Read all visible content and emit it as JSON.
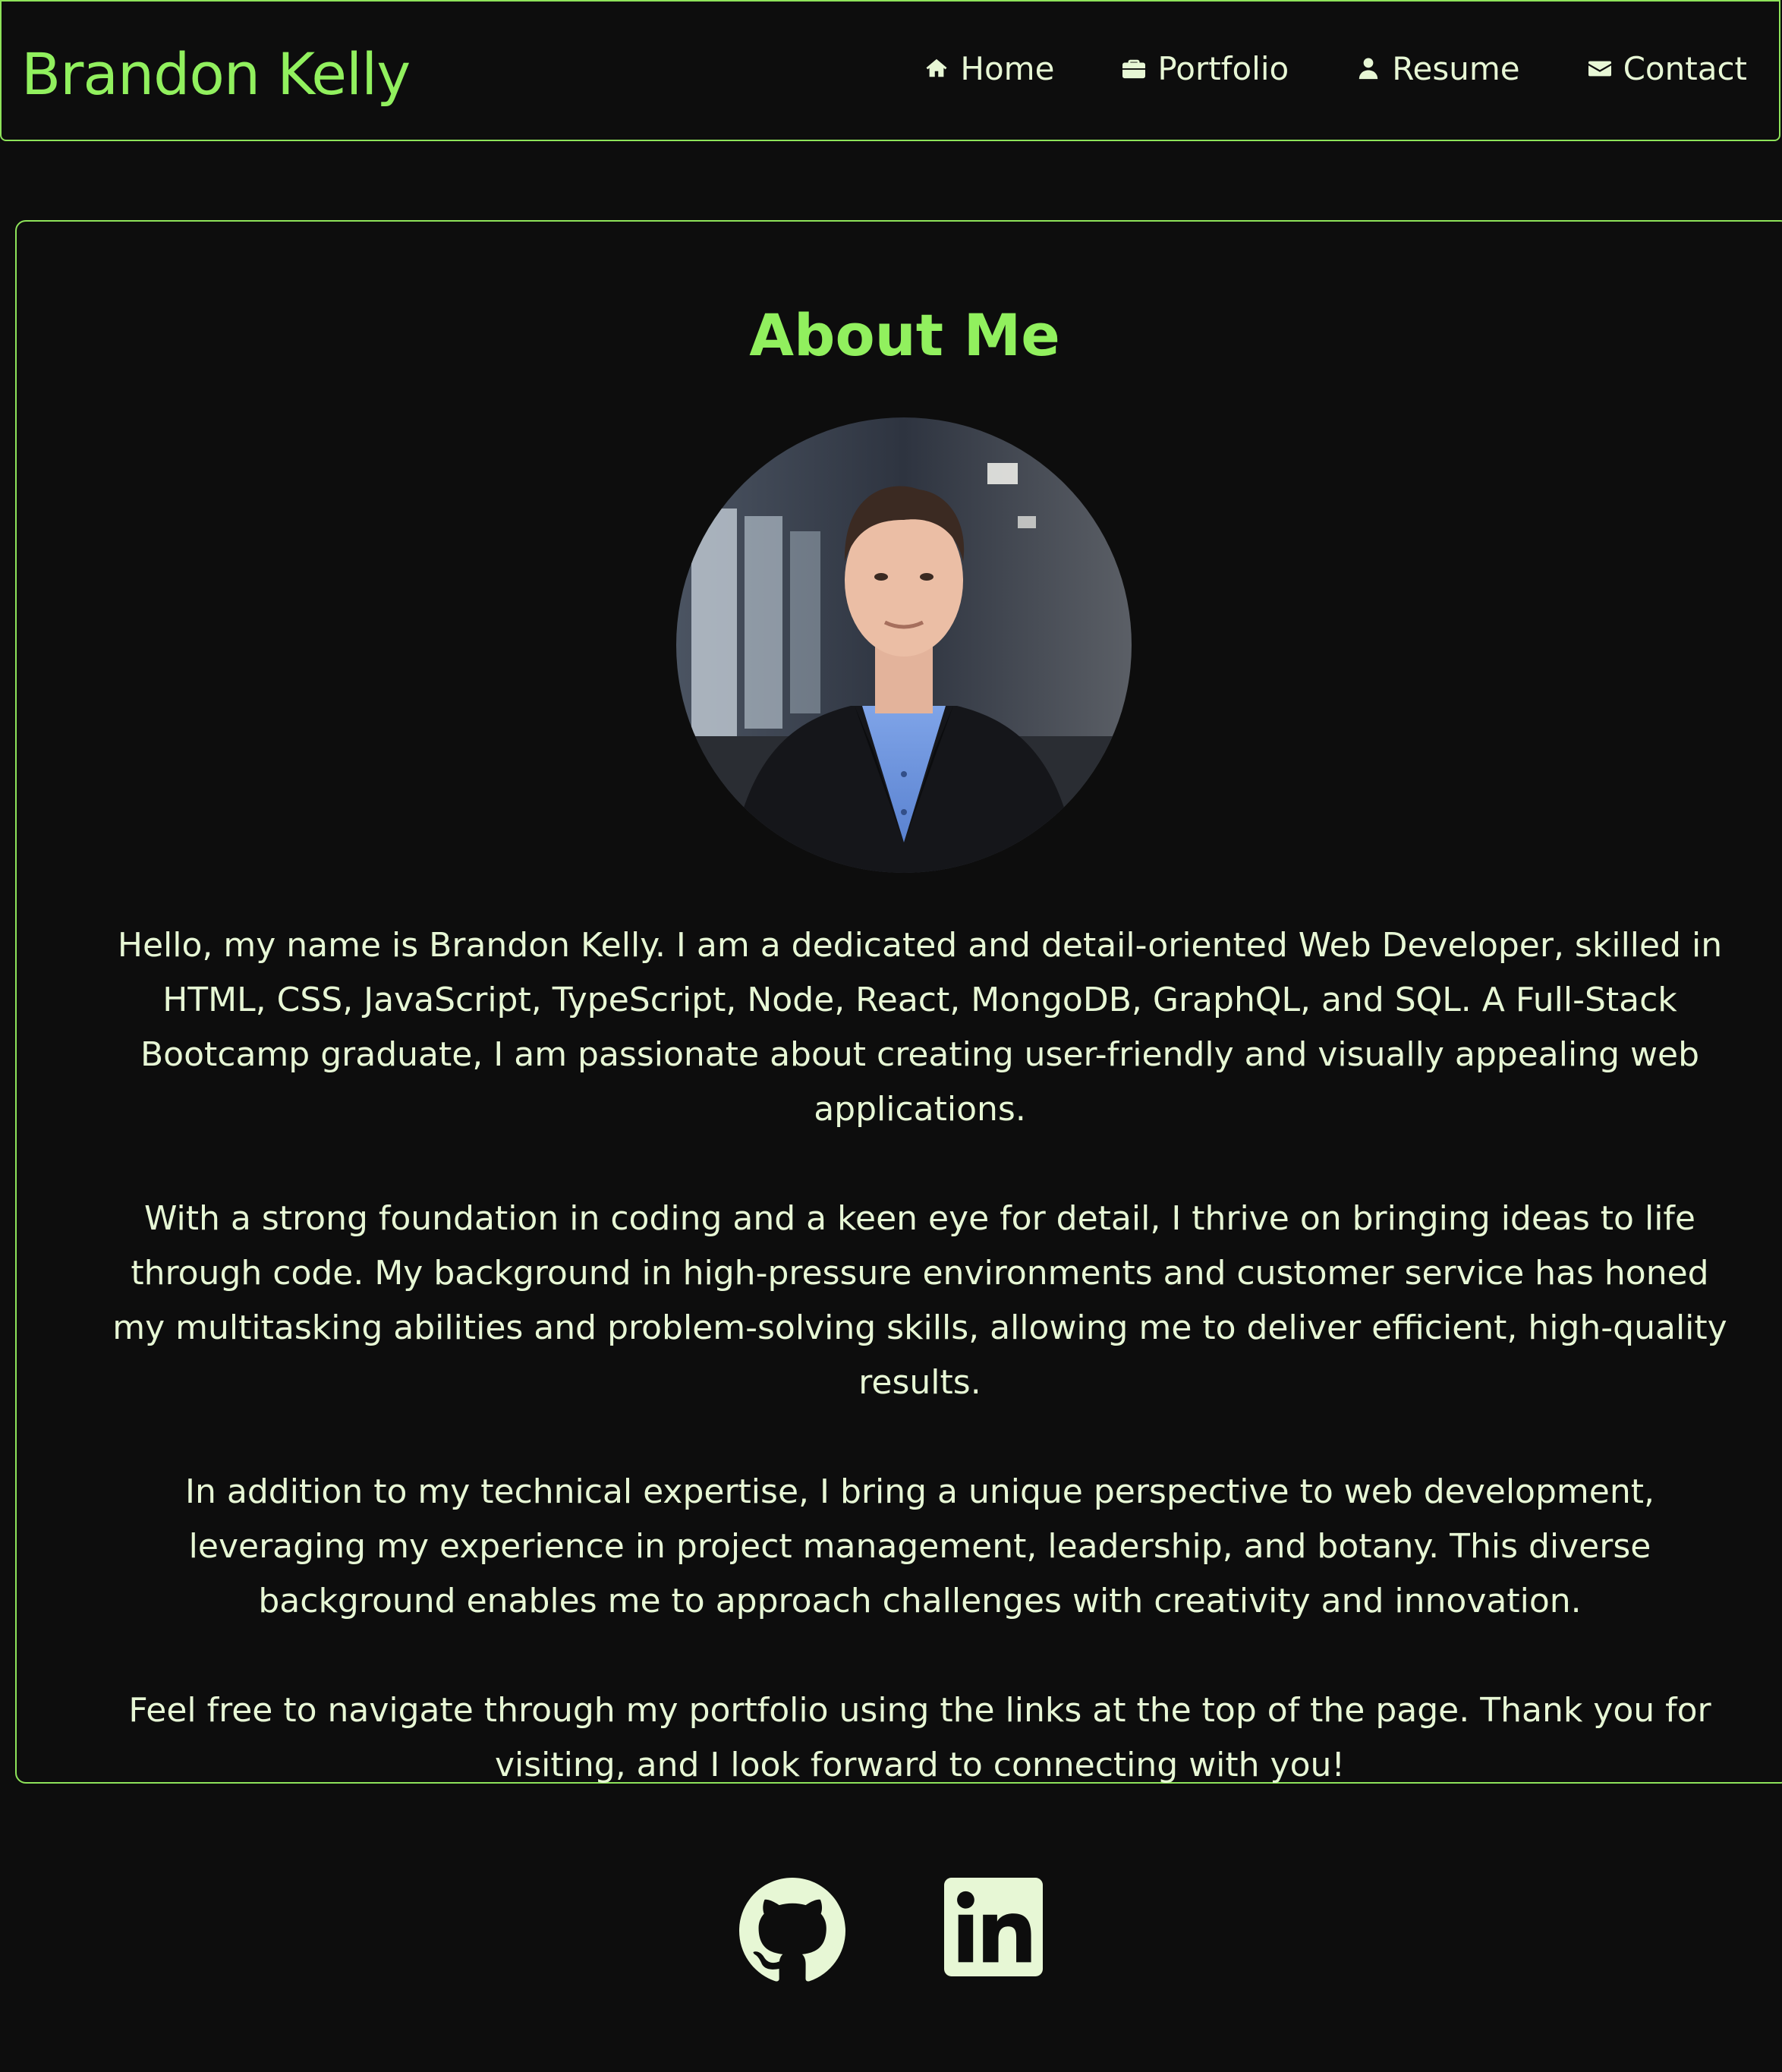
{
  "header": {
    "brand": "Brandon Kelly",
    "nav": [
      {
        "label": "Home",
        "icon": "home-icon"
      },
      {
        "label": "Portfolio",
        "icon": "briefcase-icon"
      },
      {
        "label": "Resume",
        "icon": "user-icon"
      },
      {
        "label": "Contact",
        "icon": "envelope-icon"
      }
    ]
  },
  "about": {
    "title": "About Me",
    "paragraphs": [
      "Hello, my name is Brandon Kelly. I am a dedicated and detail-oriented Web Developer, skilled in HTML, CSS, JavaScript, TypeScript, Node, React, MongoDB, GraphQL, and SQL. A Full-Stack Bootcamp graduate, I am passionate about creating user-friendly and visually appealing web applications.",
      "With a strong foundation in coding and a keen eye for detail, I thrive on bringing ideas to life through code. My background in high-pressure environments and customer service has honed my multitasking abilities and problem-solving skills, allowing me to deliver efficient, high-quality results.",
      "In addition to my technical expertise, I bring a unique perspective to web development, leveraging my experience in project management, leadership, and botany. This diverse background enables me to approach challenges with creativity and innovation.",
      "Feel free to navigate through my portfolio using the links at the top of the page. Thank you for visiting, and I look forward to connecting with you!"
    ]
  },
  "social": [
    {
      "icon": "github-icon"
    },
    {
      "icon": "linkedin-icon"
    }
  ],
  "colors": {
    "background": "#0d0d0d",
    "accent": "#91f05e",
    "text": "#e7f7d5"
  }
}
